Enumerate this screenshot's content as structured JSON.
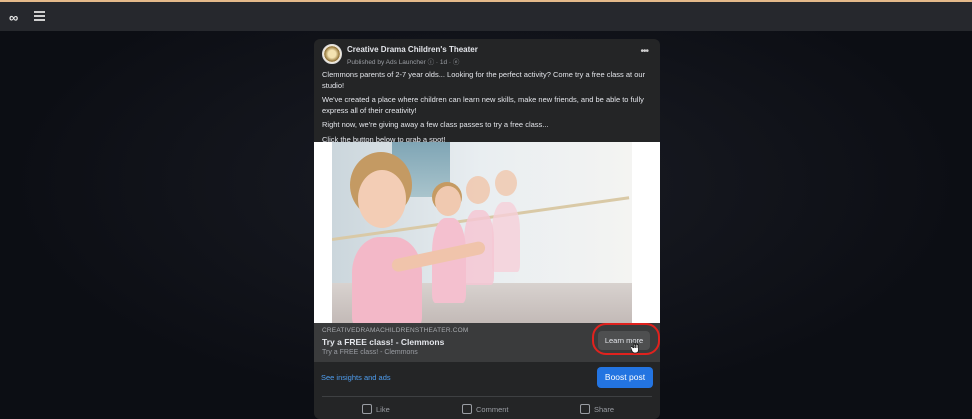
{
  "app": {
    "logo_icon": "meta-logo-icon",
    "menu_icon": "hamburger-menu-icon"
  },
  "post": {
    "page_name": "Creative Drama Children's Theater",
    "published_line": "Published by Ads Launcher ⓘ · 1d · ⓔ",
    "more_icon": "more-options-icon",
    "paragraphs": [
      "Clemmons parents of 2-7 year olds... Looking for the perfect activity? Come try a free class at our studio!",
      "We've created a place where children can learn new skills, make new friends, and be able to fully express all of their creativity!",
      "Right now, we're giving away a few class passes to try a free class...",
      "Click the button below to grab a spot!"
    ],
    "image_alt": "young girls in pink ballet outfits stretching at a barre",
    "link": {
      "domain": "CREATIVEDRAMACHILDRENSTHEATER.COM",
      "headline": "Try a FREE class! - Clemmons",
      "description": "Try a FREE class! - Clemmons",
      "cta": "Learn more"
    },
    "insights_link": "See insights and ads",
    "boost_button": "Boost post",
    "actions": [
      "Like",
      "Comment",
      "Share"
    ]
  },
  "colors": {
    "accent": "#2374e1",
    "link": "#4f9ef0",
    "highlight_ring": "#e0221e"
  }
}
